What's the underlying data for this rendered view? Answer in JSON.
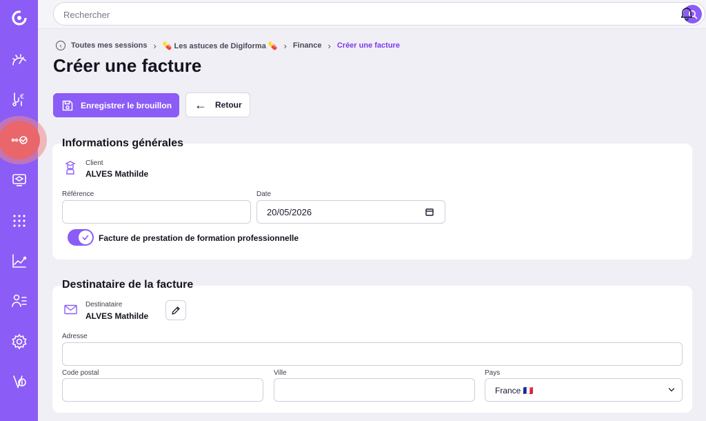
{
  "search": {
    "placeholder": "Rechercher"
  },
  "breadcrumb": {
    "items": [
      "Toutes mes sessions",
      "💊 Les astuces de Digiforma 💊",
      "Finance"
    ],
    "current": "Créer une facture"
  },
  "page": {
    "title": "Créer une facture"
  },
  "toolbar": {
    "save_label": "Enregistrer le brouillon",
    "back_label": "Retour"
  },
  "general": {
    "title": "Informations générales",
    "client_label": "Client",
    "client_value": "ALVES Mathilde",
    "reference_label": "Référence",
    "reference_value": "",
    "date_label": "Date",
    "date_value": "20/05/2026",
    "toggle_label": "Facture de prestation de formation professionnelle",
    "toggle_on": true
  },
  "recipient": {
    "title": "Destinataire de la facture",
    "recipient_label": "Destinataire",
    "recipient_value": "ALVES Mathilde",
    "address_label": "Adresse",
    "address_value": "",
    "postal_label": "Code postal",
    "postal_value": "",
    "city_label": "Ville",
    "city_value": "",
    "country_label": "Pays",
    "country_value": "France 🇫🇷"
  },
  "sidebar": {
    "items": [
      "logo-icon",
      "dashboard-icon",
      "finance-icon",
      "sessions-icon",
      "training-icon",
      "apps-icon",
      "stats-icon",
      "users-icon",
      "settings-icon",
      "help-icon"
    ],
    "active": "sessions-icon"
  },
  "colors": {
    "accent": "#8b5cf6",
    "active": "#e9666b",
    "background": "#f0eff5"
  }
}
